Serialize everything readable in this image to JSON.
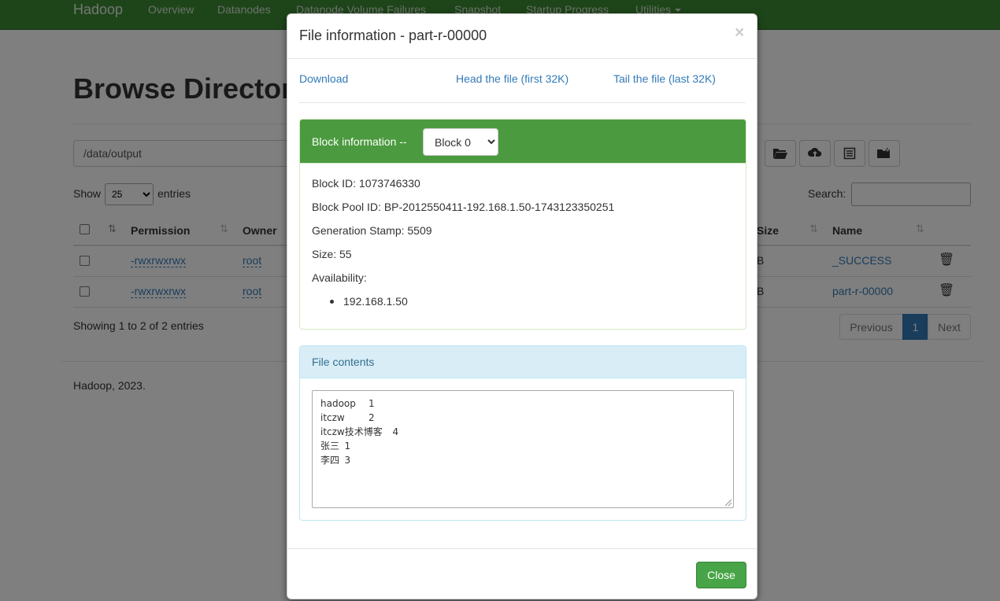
{
  "navbar": {
    "brand": "Hadoop",
    "items": [
      "Overview",
      "Datanodes",
      "Datanode Volume Failures",
      "Snapshot",
      "Startup Progress",
      "Utilities"
    ]
  },
  "page": {
    "title": "Browse Directory",
    "path_value": "/data/output",
    "show_label": "Show",
    "entries_value": "25",
    "entries_label": "entries",
    "search_label": "Search:",
    "icons": [
      "folder-open-icon",
      "upload-icon",
      "list-icon",
      "new-folder-icon"
    ]
  },
  "table": {
    "headers": [
      "Permission",
      "Owner",
      "Size",
      "Name"
    ],
    "rows": [
      {
        "permission": "-rwxrwxrwx",
        "owner": "root",
        "size": "B",
        "name": "_SUCCESS"
      },
      {
        "permission": "-rwxrwxrwx",
        "owner": "root",
        "size": "B",
        "name": "part-r-00000"
      }
    ],
    "showing": "Showing 1 to 2 of 2 entries",
    "pagination": {
      "previous": "Previous",
      "current": "1",
      "next": "Next"
    }
  },
  "footer": {
    "text": "Hadoop, 2023."
  },
  "modal": {
    "title": "File information - part-r-00000",
    "close_x": "×",
    "links": {
      "download": "Download",
      "head": "Head the file (first 32K)",
      "tail": "Tail the file (last 32K)"
    },
    "block": {
      "heading": "Block information --",
      "selected": "Block 0",
      "block_id": "Block ID: 1073746330",
      "pool_id": "Block Pool ID: BP-2012550411-192.168.1.50-1743123350251",
      "generation_stamp": "Generation Stamp: 5509",
      "size": "Size: 55",
      "availability_label": "Availability:",
      "availability": [
        "192.168.1.50"
      ]
    },
    "contents": {
      "heading": "File contents",
      "lines": [
        "hadoop\t1",
        "itczw\t2",
        "itczw技术博客\t4",
        "张三\t1",
        "李四\t3"
      ]
    },
    "close_button": "Close"
  }
}
